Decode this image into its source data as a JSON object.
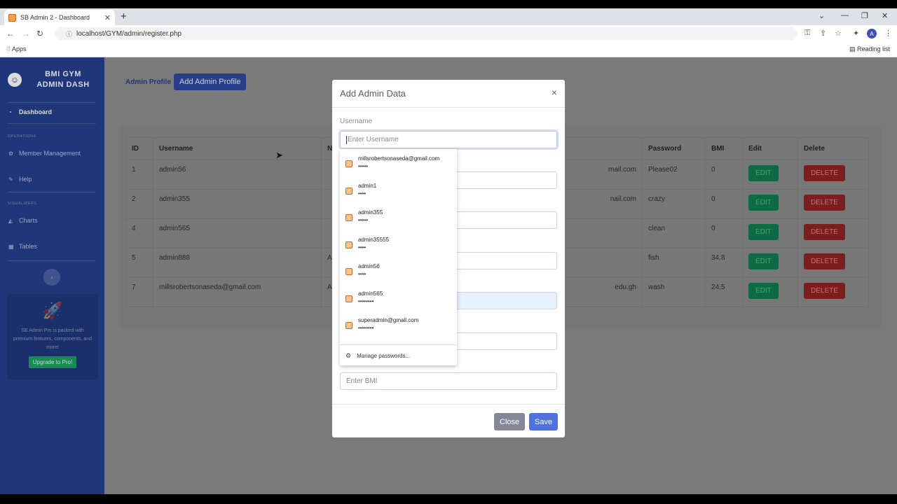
{
  "browser": {
    "tab_title": "SB Admin 2 - Dashboard",
    "url": "localhost/GYM/admin/register.php",
    "apps_label": "Apps",
    "reading_list_label": "Reading list",
    "profile_initial": "A"
  },
  "sidebar": {
    "brand_line1": "BMI GYM",
    "brand_line2": "ADMIN DASH",
    "dashboard": "Dashboard",
    "heading_operations": "OPERATIONS",
    "member_management": "Member Management",
    "help": "Help",
    "heading_visualizers": "VISUALIZERS",
    "charts": "Charts",
    "tables": "Tables",
    "promo_text": "SB Admin Pro is packed with premium features, components, and more!",
    "promo_button": "Upgrade to Pro!"
  },
  "content": {
    "admin_profile_link": "Admin Profile",
    "add_admin_button": "Add Admin Profile",
    "table": {
      "headers": [
        "ID",
        "Username",
        "N",
        "",
        "Password",
        "BMI",
        "Edit",
        "Delete"
      ],
      "rows": [
        {
          "id": "1",
          "username": "admin56",
          "name": "",
          "email": "mail.com",
          "password": "Please02",
          "bmi": "0"
        },
        {
          "id": "2",
          "username": "admin355",
          "name": "",
          "email": "nail.com",
          "password": "crazy",
          "bmi": "0"
        },
        {
          "id": "4",
          "username": "admin565",
          "name": "",
          "email": "",
          "password": "clean",
          "bmi": "0"
        },
        {
          "id": "5",
          "username": "admin888",
          "name": "A",
          "email": "",
          "password": "fish",
          "bmi": "34.8"
        },
        {
          "id": "7",
          "username": "millsrobertsonaseda@gmail.com",
          "name": "A",
          "email": "edu.gh",
          "password": "wash",
          "bmi": "24.5"
        }
      ],
      "edit_label": "EDIT",
      "delete_label": "DELETE"
    }
  },
  "modal": {
    "title": "Add Admin Data",
    "close_glyph": "×",
    "username_label": "Username",
    "username_placeholder": "Enter Username",
    "bmi_placeholder": "Enter BMI",
    "close_button": "Close",
    "save_button": "Save"
  },
  "password_dropdown": {
    "items": [
      {
        "user": "millsrobertsonaseda@gmail.com",
        "dots": "•••••"
      },
      {
        "user": "admin1",
        "dots": "••••"
      },
      {
        "user": "admin355",
        "dots": "•••••"
      },
      {
        "user": "admin35555",
        "dots": "••••"
      },
      {
        "user": "admin56",
        "dots": "••••"
      },
      {
        "user": "admin565",
        "dots": "••••••••"
      },
      {
        "user": "superadmin@gmail.com",
        "dots": "••••••••"
      }
    ],
    "manage_label": "Manage passwords..."
  }
}
